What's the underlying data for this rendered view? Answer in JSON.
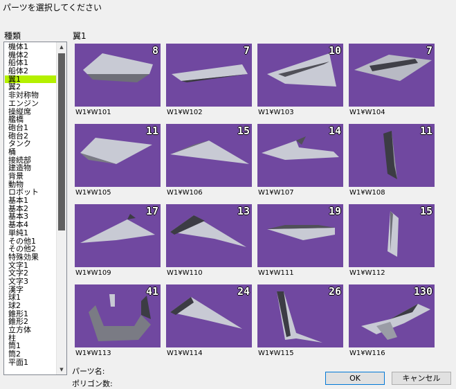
{
  "dialog": {
    "prompt": "パーツを選択してください",
    "category_label": "種類",
    "grid_title": "翼1",
    "part_name_label": "パーツ名:",
    "polygon_count_label": "ポリゴン数:",
    "ok_label": "OK",
    "cancel_label": "キャンセル"
  },
  "categories": [
    "機体1",
    "機体2",
    "船体1",
    "船体2",
    "翼1",
    "翼2",
    "非対称物",
    "エンジン",
    "操縦席",
    "艦橋",
    "砲台1",
    "砲台2",
    "タンク",
    "桶",
    "接続部",
    "建造物",
    "背景",
    "動物",
    "ロボット",
    "基本1",
    "基本2",
    "基本3",
    "基本4",
    "単純1",
    "その他1",
    "その他2",
    "特殊効果",
    "文字1",
    "文字2",
    "文字3",
    "漢字",
    "球1",
    "球2",
    "錐形1",
    "錐形2",
    "立方体",
    "柱",
    "筒1",
    "筒2",
    "平面1"
  ],
  "selected_category": "翼1",
  "parts": [
    {
      "name": "W1¥W101",
      "polygons": "8"
    },
    {
      "name": "W1¥W102",
      "polygons": "7"
    },
    {
      "name": "W1¥W103",
      "polygons": "10"
    },
    {
      "name": "W1¥W104",
      "polygons": "7"
    },
    {
      "name": "W1¥W105",
      "polygons": "11"
    },
    {
      "name": "W1¥W106",
      "polygons": "15"
    },
    {
      "name": "W1¥W107",
      "polygons": "14"
    },
    {
      "name": "W1¥W108",
      "polygons": "11"
    },
    {
      "name": "W1¥W109",
      "polygons": "17"
    },
    {
      "name": "W1¥W110",
      "polygons": "13"
    },
    {
      "name": "W1¥W111",
      "polygons": "19"
    },
    {
      "name": "W1¥W112",
      "polygons": "15"
    },
    {
      "name": "W1¥W113",
      "polygons": "41"
    },
    {
      "name": "W1¥W114",
      "polygons": "24"
    },
    {
      "name": "W1¥W115",
      "polygons": "26"
    },
    {
      "name": "W1¥W116",
      "polygons": "130"
    }
  ],
  "colors": {
    "tile_bg": "#7048a0",
    "selection": "#b4f000"
  }
}
